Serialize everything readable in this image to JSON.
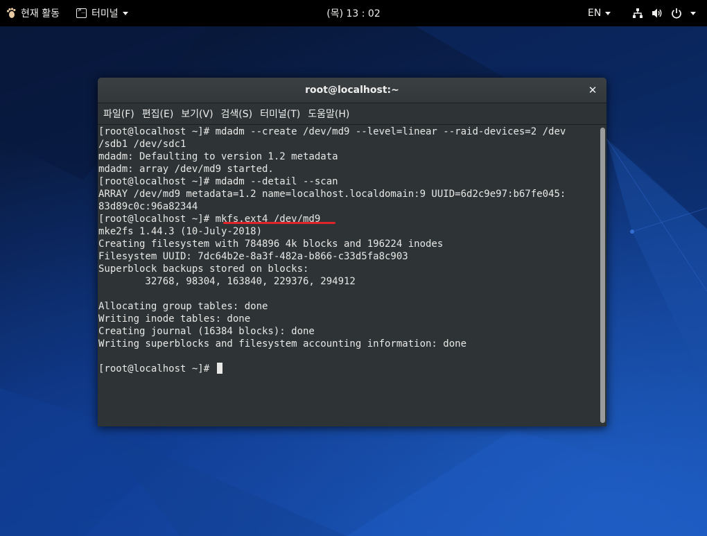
{
  "topbar": {
    "activities_label": "현재 활동",
    "app_menu_label": "터미널",
    "clock": "(목) 13 : 02",
    "language": "EN"
  },
  "window": {
    "title": "root@localhost:~",
    "close_glyph": "✕",
    "menu": [
      "파일(F)",
      "편집(E)",
      "보기(V)",
      "검색(S)",
      "터미널(T)",
      "도움말(H)"
    ]
  },
  "terminal": {
    "lines": [
      "[root@localhost ~]# mdadm --create /dev/md9 --level=linear --raid-devices=2 /dev",
      "/sdb1 /dev/sdc1",
      "mdadm: Defaulting to version 1.2 metadata",
      "mdadm: array /dev/md9 started.",
      "[root@localhost ~]# mdadm --detail --scan",
      "ARRAY /dev/md9 metadata=1.2 name=localhost.localdomain:9 UUID=6d2c9e97:b67fe045:",
      "83d89c0c:96a82344",
      "[root@localhost ~]# mkfs.ext4 /dev/md9",
      "mke2fs 1.44.3 (10-July-2018)",
      "Creating filesystem with 784896 4k blocks and 196224 inodes",
      "Filesystem UUID: 7dc64b2e-8a3f-482a-b866-c33d5fa8c903",
      "Superblock backups stored on blocks:",
      "        32768, 98304, 163840, 229376, 294912",
      "",
      "Allocating group tables: done",
      "Writing inode tables: done",
      "Creating journal (16384 blocks): done",
      "Writing superblocks and filesystem accounting information: done",
      "",
      "[root@localhost ~]# "
    ]
  },
  "icons": {
    "activities": "gnome-foot-icon",
    "app": "terminal-icon",
    "network": "network-icon",
    "volume": "volume-icon",
    "power": "power-icon"
  }
}
